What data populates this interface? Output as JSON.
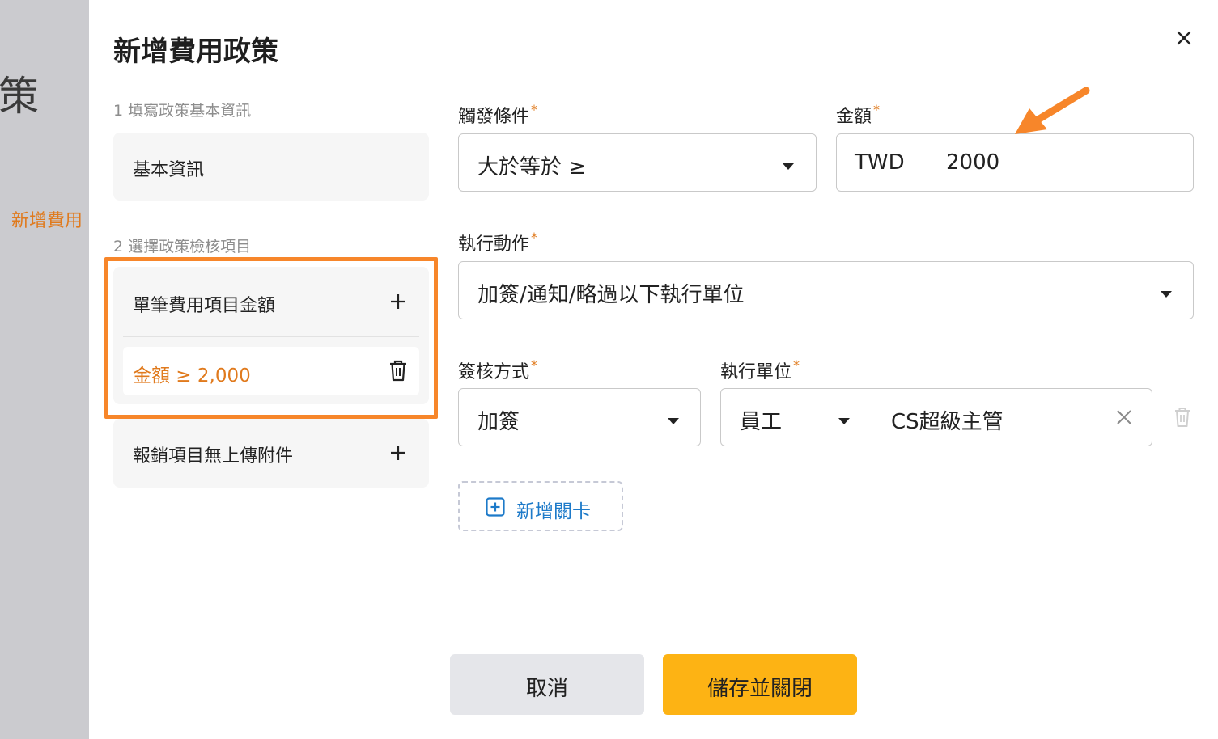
{
  "background": {
    "heading_char": "策",
    "link_text": "新增費用"
  },
  "modal": {
    "title": "新增費用政策",
    "close_icon": "close-icon"
  },
  "steps": {
    "step1_label": "1 填寫政策基本資訊",
    "basic_info_label": "基本資訊",
    "step2_label": "2 選擇政策檢核項目",
    "check_items": [
      {
        "label": "單筆費用項目金額",
        "icon": "plus-icon",
        "rules": [
          "金額 ≥ 2,000"
        ]
      },
      {
        "label": "報銷項目無上傳附件",
        "icon": "plus-icon",
        "rules": []
      }
    ]
  },
  "form": {
    "trigger_label": "觸發條件",
    "trigger_value": "大於等於 ≥",
    "amount_label": "金額",
    "currency": "TWD",
    "amount_value": "2000",
    "action_label": "執行動作",
    "action_value": "加簽/通知/略過以下執行單位",
    "approval_label": "簽核方式",
    "approval_value": "加簽",
    "unit_label": "執行單位",
    "unit_type": "員工",
    "unit_value": "CS超級主管",
    "required_mark": "*",
    "add_stage_label": "新增關卡"
  },
  "footer": {
    "cancel_label": "取消",
    "save_label": "儲存並關閉"
  },
  "colors": {
    "accent_orange": "#e07a1d",
    "highlight_orange": "#f7862a",
    "save_yellow": "#fdb314",
    "link_blue": "#1d7ac9"
  }
}
